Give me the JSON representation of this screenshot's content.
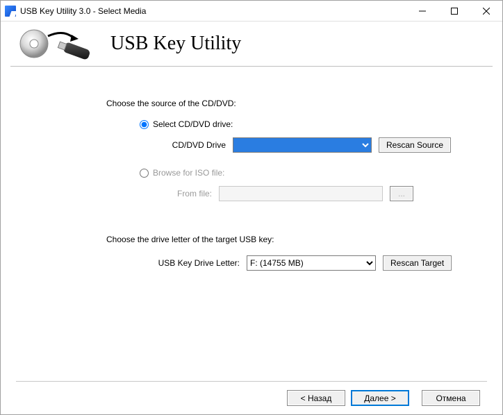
{
  "window": {
    "title": "USB Key Utility 3.0 - Select Media"
  },
  "header": {
    "appTitle": "USB Key Utility"
  },
  "source": {
    "prompt": "Choose the source of the CD/DVD:",
    "radioDrive": "Select CD/DVD drive:",
    "driveLabel": "CD/DVD Drive",
    "driveValue": "",
    "rescanSource": "Rescan Source",
    "radioISO": "Browse for ISO file:",
    "fromFileLabel": "From file:",
    "fromFileValue": "",
    "browse": "..."
  },
  "target": {
    "prompt": "Choose the drive letter of the target USB key:",
    "label": "USB Key Drive Letter:",
    "value": "F: (14755 MB)",
    "rescanTarget": "Rescan Target"
  },
  "footer": {
    "back": "< Назад",
    "next": "Далее >",
    "cancel": "Отмена"
  }
}
